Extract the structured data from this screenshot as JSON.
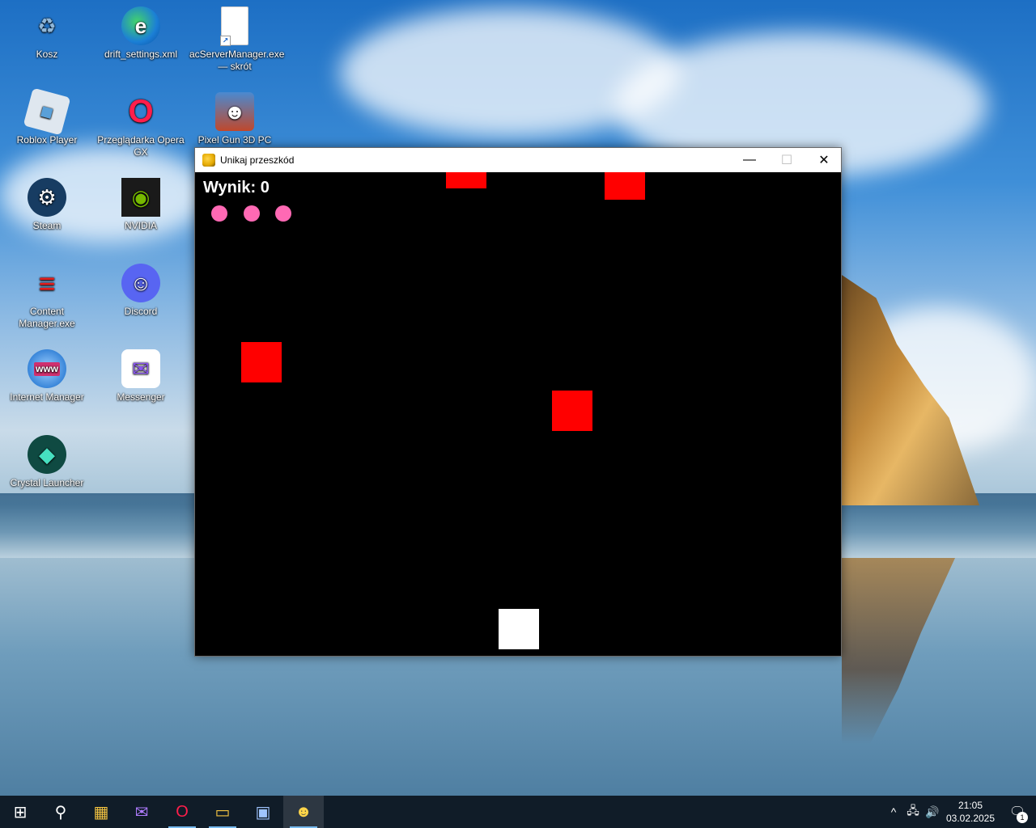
{
  "desktop": {
    "icons": [
      {
        "label": "Kosz",
        "glyph": "♻",
        "color": "#8fb6d8"
      },
      {
        "label": "drift_settings.xml",
        "glyph": "e",
        "color": "#1b7fd6"
      },
      {
        "label": "acServerManager.exe — skrót",
        "glyph": "",
        "color": "#ffffff"
      },
      {
        "label": "Roblox Player",
        "glyph": "■",
        "color": "#dfe7ef"
      },
      {
        "label": "Przeglądarka Opera GX",
        "glyph": "O",
        "color": "#ff1e4b"
      },
      {
        "label": "Pixel Gun 3D PC",
        "glyph": "☻",
        "color": "#3a6fb0"
      },
      {
        "label": "Steam",
        "glyph": "⚙",
        "color": "#173c62"
      },
      {
        "label": "NVIDIA",
        "glyph": "◉",
        "color": "#1a1a1a"
      },
      {
        "label": "Content Manager.exe",
        "glyph": "≡",
        "color": "#e21d1d"
      },
      {
        "label": "Discord",
        "glyph": "☺",
        "color": "#5865f2"
      },
      {
        "label": "Internet Manager",
        "glyph": "www",
        "color": "#2a7bd4"
      },
      {
        "label": "Messenger",
        "glyph": "✉",
        "color": "#8a55f0"
      },
      {
        "label": "Crystal Launcher",
        "glyph": "◆",
        "color": "#0f4a42"
      }
    ]
  },
  "window": {
    "title": "Unikaj przeszkód",
    "minimize_glyph": "—",
    "maximize_glyph": "☐",
    "close_glyph": "✕"
  },
  "game": {
    "score_text": "Wynik: 0",
    "lives": 3,
    "obstacle_color": "#ff0000",
    "player_color": "#ffffff",
    "life_color": "#ff69b4"
  },
  "taskbar": {
    "apps": [
      {
        "name": "start",
        "glyph": "⊞"
      },
      {
        "name": "search",
        "glyph": "⚲"
      },
      {
        "name": "store",
        "glyph": "▦"
      },
      {
        "name": "messenger",
        "glyph": "✉"
      },
      {
        "name": "opera",
        "glyph": "O"
      },
      {
        "name": "explorer",
        "glyph": "▭"
      },
      {
        "name": "app",
        "glyph": "▣"
      },
      {
        "name": "python",
        "glyph": "☻"
      }
    ],
    "tray": {
      "chevron": "^",
      "network": "🖧",
      "volume": "🔊",
      "time": "21:05",
      "date": "03.02.2025",
      "notification_glyph": "🗨",
      "notification_count": "1"
    }
  }
}
